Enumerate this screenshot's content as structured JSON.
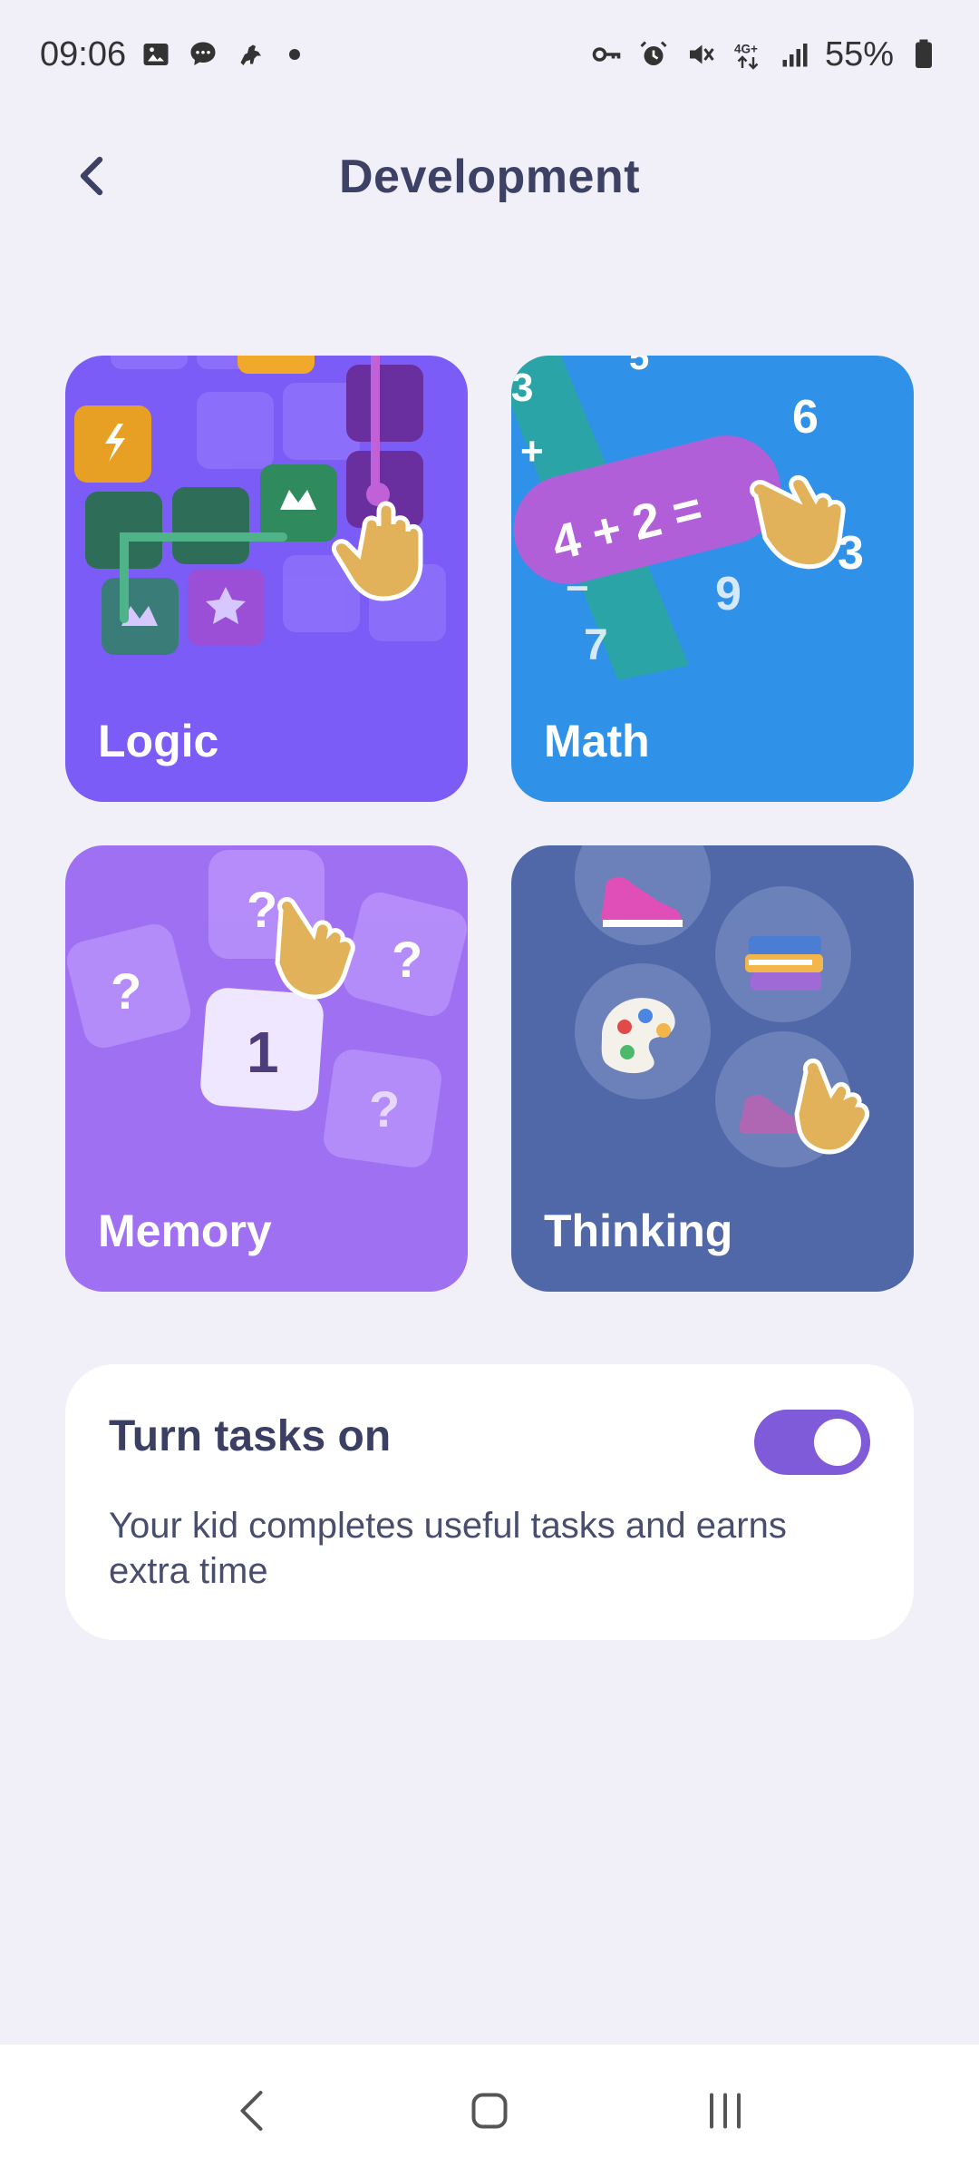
{
  "status_bar": {
    "time": "09:06",
    "battery": "55%",
    "network": "4G+",
    "icons": [
      "gallery-icon",
      "chat-bubble-icon",
      "game-icon",
      "dot-icon",
      "vpn-key-icon",
      "alarm-icon",
      "mute-icon",
      "network-4g-icon",
      "signal-icon",
      "battery-icon"
    ]
  },
  "header": {
    "title": "Development",
    "back_icon": "chevron-left-icon"
  },
  "categories": [
    {
      "label": "Logic",
      "color": "#7b5cf6"
    },
    {
      "label": "Math",
      "color": "#2f92e8"
    },
    {
      "label": "Memory",
      "color": "#a070f2"
    },
    {
      "label": "Thinking",
      "color": "#5168a8"
    }
  ],
  "tasks": {
    "title": "Turn tasks on",
    "description": "Your kid completes useful tasks and earns extra time",
    "toggle_on": true,
    "toggle_color": "#7f5ad9"
  },
  "nav_bar": {
    "icons": [
      "nav-back-icon",
      "nav-home-icon",
      "nav-recents-icon"
    ]
  }
}
